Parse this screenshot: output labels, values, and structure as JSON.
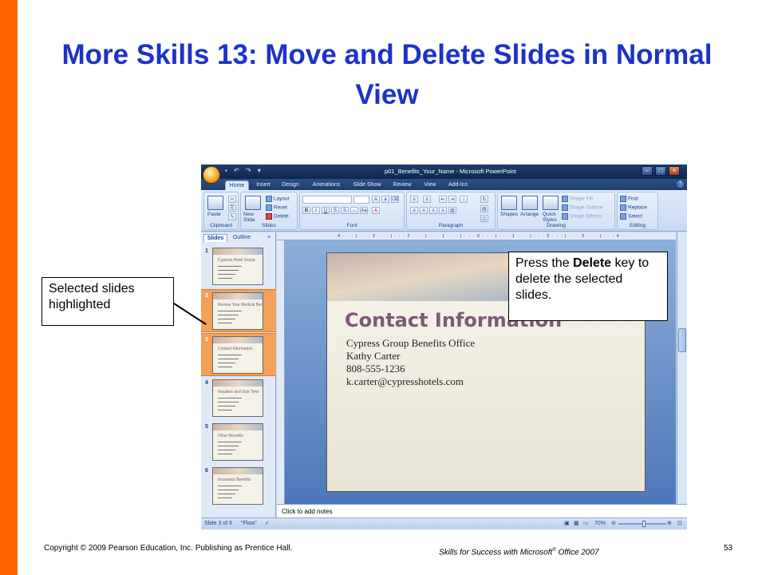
{
  "slide_title": "More Skills 13: Move and Delete Slides in Normal View",
  "callouts": {
    "left": "Selected slides highlighted",
    "right_before": "Press the ",
    "right_bold": "Delete",
    "right_after": " key to delete the selected slides."
  },
  "footer": {
    "copyright": "Copyright © 2009 Pearson Education, Inc. Publishing as Prentice Hall.",
    "series_prefix": "Skills for Success with Microsoft",
    "series_sup": "®",
    "series_suffix": " Office 2007",
    "page_number": "53"
  },
  "window": {
    "title": "p01_Benefits_Your_Name - Microsoft PowerPoint"
  },
  "ribbon_tabs": [
    "Home",
    "Insert",
    "Design",
    "Animations",
    "Slide Show",
    "Review",
    "View",
    "Add-Ins"
  ],
  "ribbon": {
    "clipboard": {
      "label": "Clipboard",
      "paste": "Paste"
    },
    "slides": {
      "label": "Slides",
      "new_slide": "New Slide",
      "layout": "Layout",
      "reset": "Reset",
      "delete": "Delete"
    },
    "font": {
      "label": "Font"
    },
    "paragraph": {
      "label": "Paragraph"
    },
    "drawing": {
      "label": "Drawing",
      "shapes": "Shapes",
      "arrange": "Arrange",
      "quick_styles": "Quick Styles",
      "shape_fill": "Shape Fill",
      "shape_outline": "Shape Outline",
      "shape_effects": "Shape Effects"
    },
    "editing": {
      "label": "Editing",
      "find": "Find",
      "replace": "Replace",
      "select": "Select"
    }
  },
  "panel_tabs": {
    "slides": "Slides",
    "outline": "Outline"
  },
  "thumbnails": [
    {
      "num": "1",
      "title": "Cypress Hotel Group",
      "selected": false
    },
    {
      "num": "2",
      "title": "Review Your Medical Benefits Early",
      "selected": true
    },
    {
      "num": "3",
      "title": "Contact Information",
      "selected": true
    },
    {
      "num": "4",
      "title": "Vacation and Sick Time",
      "selected": false
    },
    {
      "num": "5",
      "title": "Other Benefits",
      "selected": false
    },
    {
      "num": "6",
      "title": "Insurance Benefits",
      "selected": false
    }
  ],
  "slide": {
    "title": "Contact Information",
    "lines": [
      "Cypress Group Benefits Office",
      "Kathy Carter",
      "808-555-1236",
      "k.carter@cypresshotels.com"
    ]
  },
  "notes_placeholder": "Click to add notes",
  "status": {
    "slide_info": "Slide 3 of 6",
    "theme": "\"Flow\"",
    "zoom": "70%"
  }
}
